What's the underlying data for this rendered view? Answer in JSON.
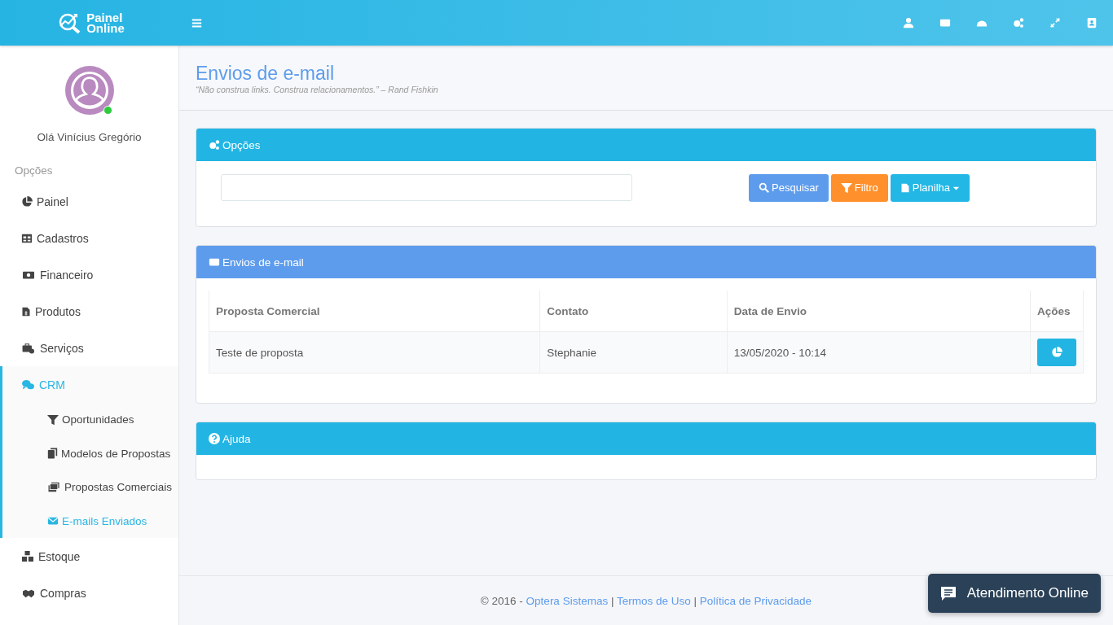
{
  "logo": {
    "line1": "Painel",
    "line2": "Online"
  },
  "user": {
    "greeting": "Olá Vinícius Gregório",
    "online": true
  },
  "sidebar": {
    "section": "Opções",
    "items": [
      {
        "label": "Painel",
        "expanded": false
      },
      {
        "label": "Cadastros",
        "expanded": false
      },
      {
        "label": "Financeiro",
        "expanded": false
      },
      {
        "label": "Produtos",
        "expanded": false
      },
      {
        "label": "Serviços",
        "expanded": false
      },
      {
        "label": "CRM",
        "expanded": true,
        "children": [
          {
            "label": "Oportunidades",
            "selected": false
          },
          {
            "label": "Modelos de Propostas",
            "selected": false
          },
          {
            "label": "Propostas Comerciais",
            "selected": false
          },
          {
            "label": "E-mails Enviados",
            "selected": true
          }
        ]
      },
      {
        "label": "Estoque",
        "expanded": false
      },
      {
        "label": "Compras",
        "expanded": false
      }
    ]
  },
  "page": {
    "title": "Envios de e-mail",
    "quote": "“Não construa links. Construa relacionamentos.” – Rand Fishkin"
  },
  "panels": [
    {
      "kind": "options",
      "title": "Opções",
      "buttons": [
        {
          "kind": "search",
          "label": "Pesquisar"
        },
        {
          "kind": "filter",
          "label": "Filtro"
        },
        {
          "kind": "dropdown",
          "label": "Planilha"
        }
      ]
    },
    {
      "kind": "table",
      "title": "Envios de e-mail",
      "columns": [
        "Proposta Comercial",
        "Contato",
        "Data de Envio",
        "Ações"
      ],
      "rows": [
        [
          "Teste de proposta",
          "Stephanie",
          "13/05/2020 - 10:14"
        ]
      ]
    },
    {
      "kind": "help",
      "title": "Ajuda"
    }
  ],
  "footer": [
    {
      "kind": "text",
      "text": "© 2016 -"
    },
    {
      "kind": "link",
      "text": "Optera Sistemas"
    },
    {
      "kind": "text",
      "text": "|"
    },
    {
      "kind": "link",
      "text": "Termos de Uso"
    },
    {
      "kind": "text",
      "text": "|"
    },
    {
      "kind": "link",
      "text": "Política de Privacidade"
    }
  ],
  "chat": {
    "label": "Atendimento Online"
  }
}
